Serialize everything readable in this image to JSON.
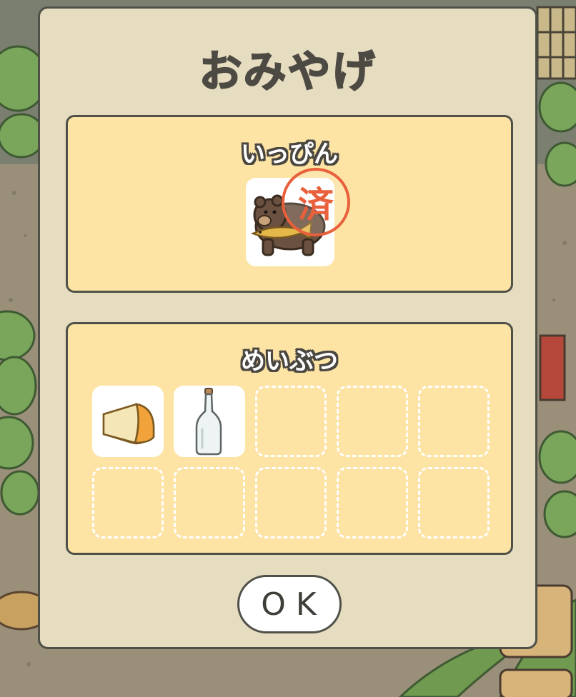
{
  "dialog": {
    "title": "おみやげ",
    "ok_label": "OK"
  },
  "specialty": {
    "label": "いっぴん",
    "item": {
      "icon": "bear-with-fish-icon",
      "stamp": "済"
    }
  },
  "souvenirs": {
    "label": "めいぶつ",
    "slots": [
      {
        "icon": "cheese-icon",
        "filled": true
      },
      {
        "icon": "glass-bottle-icon",
        "filled": true
      },
      {
        "filled": false
      },
      {
        "filled": false
      },
      {
        "filled": false
      },
      {
        "filled": false
      },
      {
        "filled": false
      },
      {
        "filled": false
      },
      {
        "filled": false
      },
      {
        "filled": false
      }
    ]
  },
  "colors": {
    "modal_bg": "#e6dcc0",
    "panel_bg": "#fde3a4",
    "border": "#4f5148",
    "stamp": "#e8603c"
  }
}
